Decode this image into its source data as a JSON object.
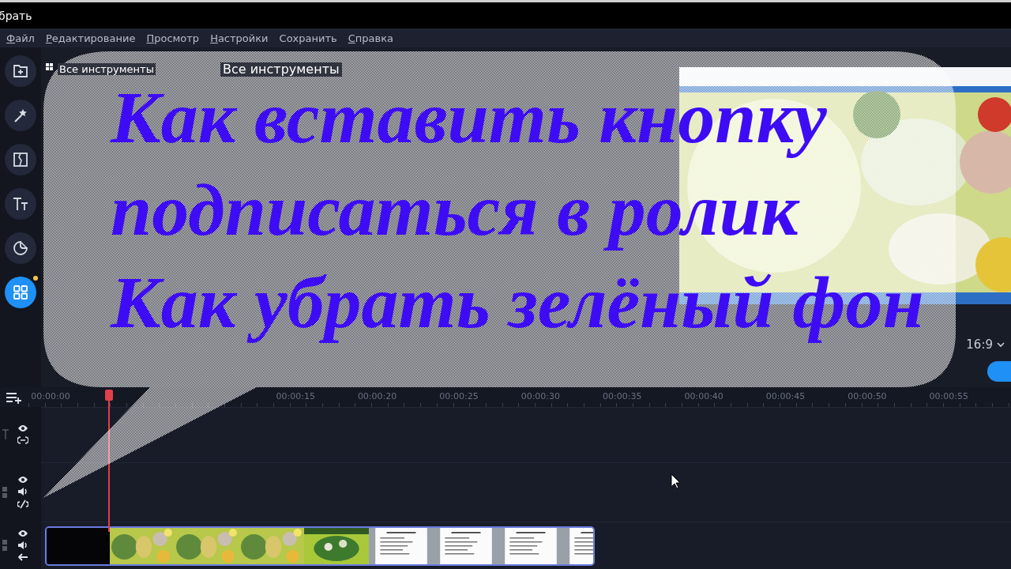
{
  "title_bar": {
    "title": "брать"
  },
  "menu": [
    {
      "label": "Файл",
      "mnemonic": true
    },
    {
      "label": "Редактирование",
      "mnemonic": true
    },
    {
      "label": "Просмотр",
      "mnemonic": true
    },
    {
      "label": "Настройки",
      "mnemonic": true
    },
    {
      "label": "Сохранить",
      "mnemonic": false
    },
    {
      "label": "Справка",
      "mnemonic": true
    }
  ],
  "tools": [
    {
      "kind": "import",
      "selected": false
    },
    {
      "kind": "effects",
      "selected": false
    },
    {
      "kind": "transitions",
      "selected": false
    },
    {
      "kind": "titles",
      "selected": false
    },
    {
      "kind": "stickers",
      "selected": false
    },
    {
      "kind": "all",
      "selected": true,
      "notification": true
    }
  ],
  "panel": {
    "tab_label": "Все инструменты",
    "heading": "Все инструменты"
  },
  "callout": {
    "lines": [
      "Как вставить кнопку",
      "подписаться в ролик",
      "Как убрать зелёный фон"
    ]
  },
  "preview": {
    "aspect": "16:9"
  },
  "timeline": {
    "ticks": [
      "00:00:00",
      "00:00:15",
      "00:00:20",
      "00:00:25",
      "00:00:30",
      "00:00:35",
      "00:00:40",
      "00:00:45",
      "00:00:50",
      "00:00:55"
    ],
    "tracks": [
      {
        "kind": "text"
      },
      {
        "kind": "overlay"
      },
      {
        "kind": "video"
      }
    ],
    "clips": [
      {
        "kind": "blank"
      },
      {
        "kind": "food"
      },
      {
        "kind": "food"
      },
      {
        "kind": "food"
      },
      {
        "kind": "salad"
      },
      {
        "kind": "document"
      },
      {
        "kind": "document"
      },
      {
        "kind": "document"
      },
      {
        "kind": "document"
      }
    ]
  }
}
